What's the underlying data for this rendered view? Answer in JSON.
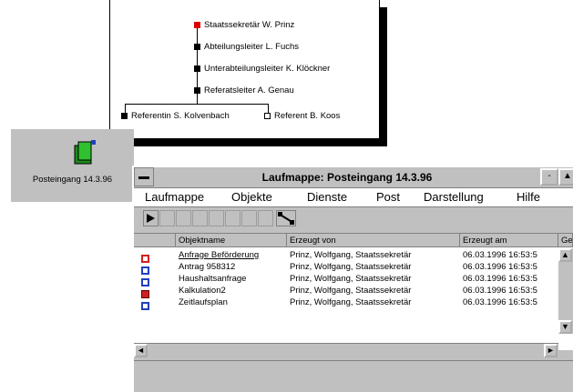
{
  "org_chart": {
    "nodes": [
      "Staatssekretär W. Prinz",
      "Abteilungsleiter L. Fuchs",
      "Unterabteilungsleiter K. Klöckner",
      "Referatsleiter A. Genau",
      "Referentin S. Kolvenbach",
      "Referent B. Koos"
    ],
    "colors": {
      "highlight": "#e00000",
      "node": "#000000"
    }
  },
  "desktop_icon": {
    "label": "Posteingang 14.3.96",
    "icon": "folder-mail-icon"
  },
  "window": {
    "title": "Laufmappe: Posteingang 14.3.96",
    "controls": {
      "minimize": "-",
      "maximize": "▲"
    },
    "menu": [
      "Laufmappe",
      "Objekte",
      "Dienste",
      "Post",
      "Darstellung",
      "Hilfe"
    ],
    "toolbar_icons": [
      "forward-icon",
      "copy-icon",
      "print-icon",
      "paste-icon",
      "cut-icon",
      "undo-icon",
      "delete-icon",
      "preview-icon",
      "route-icon"
    ],
    "table": {
      "columns": [
        "Objektname",
        "Erzeugt von",
        "Erzeugt am",
        "Ge"
      ],
      "rows": [
        {
          "icon": "document-red-icon",
          "name": "Anfrage Beförderung",
          "by": "Prinz, Wolfgang, Staatssekretär",
          "at": "06.03.1996 16:53:5"
        },
        {
          "icon": "document-blue-icon",
          "name": "Antrag 958312",
          "by": "Prinz, Wolfgang, Staatssekretär",
          "at": "06.03.1996 16:53:5"
        },
        {
          "icon": "document-blue-icon",
          "name": "Haushaltsanfrage",
          "by": "Prinz, Wolfgang, Staatssekretär",
          "at": "06.03.1996 16:53:5"
        },
        {
          "icon": "spreadsheet-icon",
          "name": "Kalkulation2",
          "by": "Prinz, Wolfgang, Staatssekretär",
          "at": "06.03.1996 16:53:5"
        },
        {
          "icon": "document-blue-icon",
          "name": "Zeitlaufsplan",
          "by": "Prinz, Wolfgang, Staatssekretär",
          "at": "06.03.1996 16:53:5"
        }
      ]
    },
    "scroll_arrows": {
      "left": "◄",
      "right": "►",
      "up": "▲",
      "down": "▼"
    }
  }
}
